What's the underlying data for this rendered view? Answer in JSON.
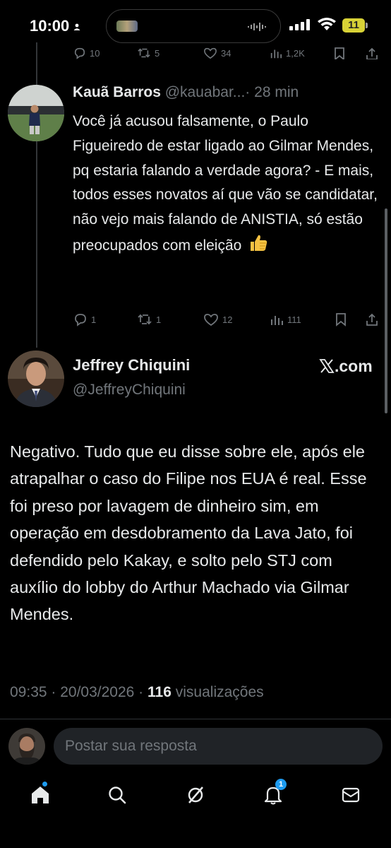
{
  "status_bar": {
    "time": "10:00",
    "battery": "11",
    "icons": [
      "person-icon",
      "signal-icon",
      "wifi-icon",
      "battery-icon"
    ]
  },
  "previous_tweet_actions": {
    "replies": "10",
    "retweets": "5",
    "likes": "34",
    "views": "1,2K"
  },
  "reply": {
    "name": "Kauã Barros",
    "handle": "@kauabar...",
    "separator": "·",
    "time": "28 min",
    "text": "Você já acusou falsamente, o Paulo Figueiredo de estar ligado ao Gilmar Mendes, pq estaria falando a verdade agora? - E mais, todos esses novatos aí que vão se candidatar, não vejo mais falando de ANISTIA, só estão preocupados com eleição",
    "emoji": "thumbs-up",
    "actions": {
      "replies": "1",
      "retweets": "1",
      "likes": "12",
      "views": "111"
    }
  },
  "main_tweet": {
    "name": "Jeffrey Chiquini",
    "handle": "@JeffreyChiquini",
    "source": ".com",
    "text": "Negativo. Tudo que eu disse sobre ele, após ele atrapalhar o caso do Filipe nos EUA é real. Esse foi preso por lavagem de dinheiro sim, em operação em desdobramento da Lava Jato, foi defendido pelo Kakay, e solto pelo STJ com auxílio do lobby do Arthur Machado via Gilmar Mendes.",
    "time": "09:35",
    "date": "20/03/2026",
    "separator": " · ",
    "views_count": "116",
    "views_label": "visualizações"
  },
  "reply_box": {
    "placeholder": "Postar sua resposta"
  },
  "tab_bar": {
    "items": [
      "home-icon",
      "search-icon",
      "grok-icon",
      "notifications-icon",
      "messages-icon"
    ],
    "notification_count": "1"
  },
  "colors": {
    "background": "#000000",
    "text": "#e7e9ea",
    "muted": "#71767b",
    "accent": "#1d9bf0",
    "battery": "#d8d236",
    "emoji": "#f5c242"
  }
}
